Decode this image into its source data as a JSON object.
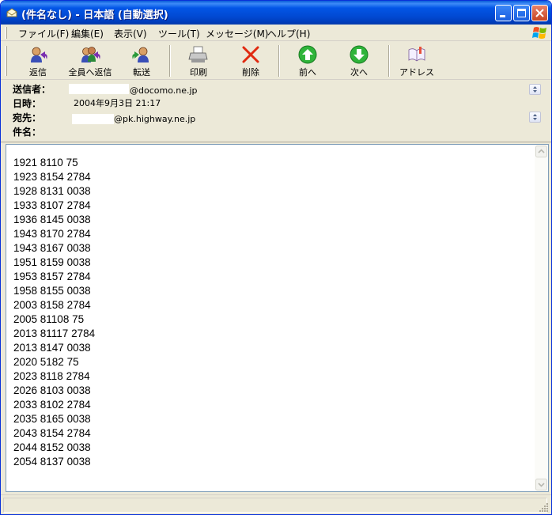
{
  "window": {
    "title": "(件名なし) - 日本語 (自動選択)"
  },
  "menu": {
    "items": [
      "ファイル(F)",
      "編集(E)",
      "表示(V)",
      "ツール(T)",
      "メッセージ(M)",
      "ヘルプ(H)"
    ]
  },
  "toolbar": {
    "reply": "返信",
    "reply_all": "全員へ返信",
    "forward": "転送",
    "print": "印刷",
    "delete": "削除",
    "previous": "前へ",
    "next": "次へ",
    "addresses": "アドレス"
  },
  "header": {
    "from_label": "送信者：",
    "from_value": "@docomo.ne.jp",
    "date_label": "日時：",
    "date_value": "2004年9月3日  21:17",
    "to_label": "宛先：",
    "to_value": "@pk.highway.ne.jp",
    "subject_label": "件名：",
    "subject_value": ""
  },
  "message": {
    "lines": [
      "1921 8110 75",
      "1923 8154 2784",
      "1928 8131 0038",
      "1933 8107 2784",
      "1936 8145 0038",
      "1943 8170 2784",
      "1943 8167 0038",
      "1951 8159 0038",
      "1953 8157 2784",
      "1958 8155 0038",
      "2003 8158 2784",
      "2005 81108 75",
      "2013 81117 2784",
      "2013 8147 0038",
      "2020 5182 75",
      "2023 8118 2784",
      "2026 8103 0038",
      "2033 8102 2784",
      "2035 8165 0038",
      "2043 8154 2784",
      "2044 8152 0038",
      "2054 8137 0038"
    ]
  },
  "colors": {
    "titlebar": "#0054e3",
    "chrome": "#ece9d8",
    "body_border": "#7f9db9"
  }
}
